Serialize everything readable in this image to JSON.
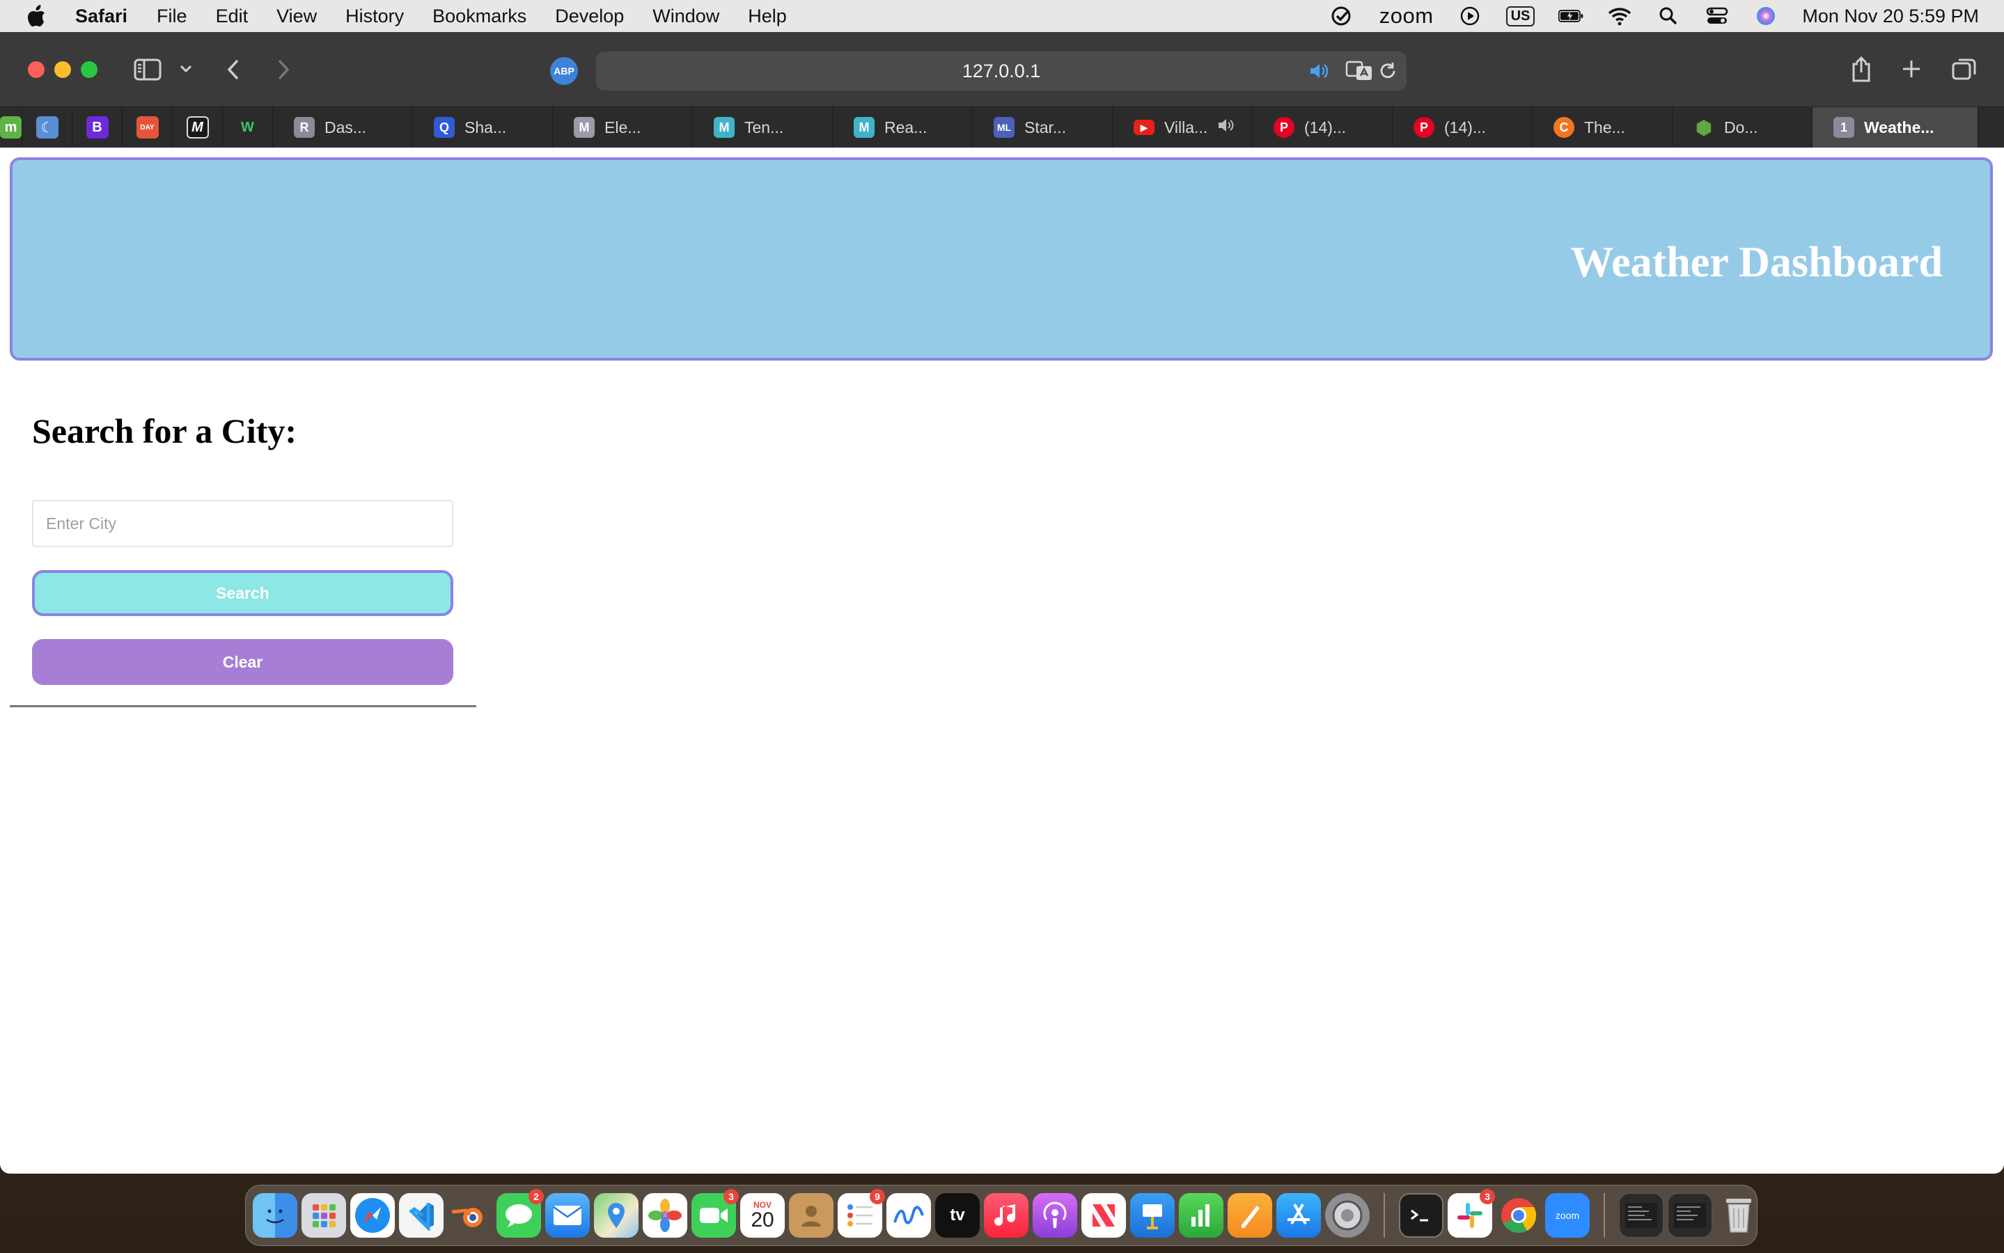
{
  "menubar": {
    "items": [
      "Safari",
      "File",
      "Edit",
      "View",
      "History",
      "Bookmarks",
      "Develop",
      "Window",
      "Help"
    ],
    "zoom_label": "zoom",
    "input_source": "US",
    "clock": "Mon Nov 20  5:59 PM"
  },
  "browser": {
    "url": "127.0.0.1",
    "adblock_label": "ABP",
    "tabs": [
      {
        "label": "Das...",
        "icon": "R",
        "color": "#8a8a9a"
      },
      {
        "label": "Sha...",
        "icon": "Q",
        "color": "#2f5bd8"
      },
      {
        "label": "Ele...",
        "icon": "M",
        "color": "#9a9aa8"
      },
      {
        "label": "Ten...",
        "icon": "M",
        "color": "#3fb4c8"
      },
      {
        "label": "Rea...",
        "icon": "M",
        "color": "#3fb4c8"
      },
      {
        "label": "Star...",
        "icon": "ML",
        "color": "#4a63b8"
      },
      {
        "label": "Villa...",
        "icon": "▶",
        "color": "#e62117"
      },
      {
        "label": "(14)...",
        "icon": "P",
        "color": "#e60023"
      },
      {
        "label": "(14)...",
        "icon": "P",
        "color": "#e60023"
      },
      {
        "label": "The...",
        "icon": "C",
        "color": "#f47521"
      },
      {
        "label": "Do...",
        "icon": "⬢",
        "color": "#5fa845"
      },
      {
        "label": "Weathe...",
        "icon": "1",
        "color": "#8a8a9a"
      }
    ],
    "pinned": [
      {
        "icon": "m",
        "color": "#5fb347"
      },
      {
        "icon": "☾",
        "color": "#5a8fd8"
      },
      {
        "icon": "B",
        "color": "#6a2bd9"
      },
      {
        "icon": "DAY",
        "color": "#e8543a"
      },
      {
        "icon": "M",
        "color": "#1a1a1a"
      },
      {
        "icon": "W",
        "color": "#2b2b2b"
      }
    ]
  },
  "page": {
    "header_title": "Weather Dashboard",
    "search_heading": "Search for a City:",
    "city_input_placeholder": "Enter City",
    "city_input_value": "",
    "search_button": "Search",
    "clear_button": "Clear"
  },
  "dock": {
    "badges": {
      "messages": "2",
      "facetime": "3",
      "reminders": "9",
      "slack": "3"
    },
    "calendar_month": "NOV",
    "calendar_day": "20",
    "tv_label": "tv",
    "zoom_label": "zoom"
  }
}
